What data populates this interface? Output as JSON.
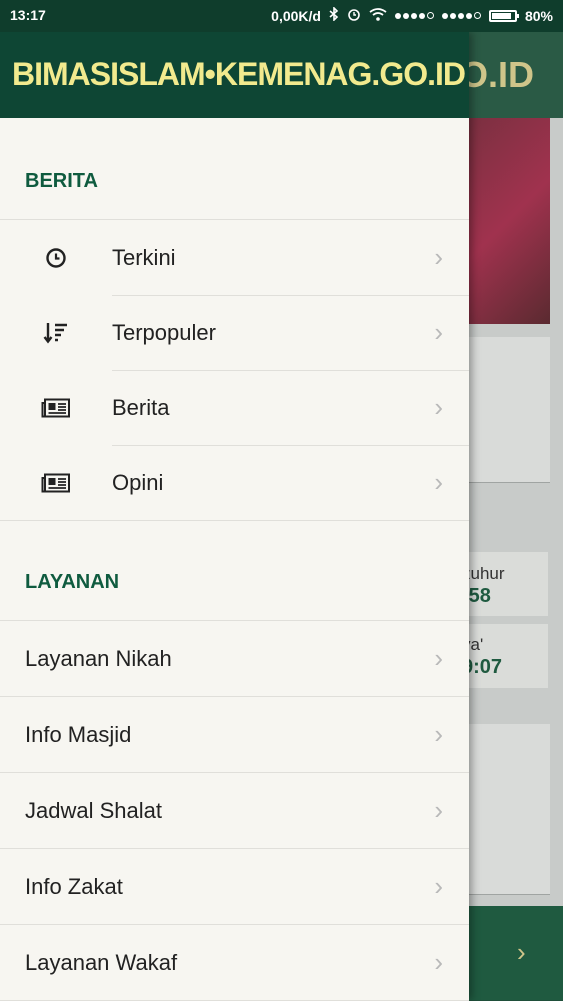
{
  "status_bar": {
    "time": "13:17",
    "speed": "0,00K/d",
    "battery": "80%"
  },
  "background_app": {
    "header_fragment": "O.ID",
    "prayer_1_name": "zuhur",
    "prayer_1_time": ":58",
    "prayer_2_name": "ya'",
    "prayer_2_time": "9:07"
  },
  "drawer": {
    "logo": "BIMASISLAM•KEMENAG.GO.ID",
    "sections": {
      "berita": {
        "title": "BERITA",
        "items": [
          {
            "label": "Terkini",
            "icon": "clock-icon"
          },
          {
            "label": "Terpopuler",
            "icon": "sort-icon"
          },
          {
            "label": "Berita",
            "icon": "newspaper-icon"
          },
          {
            "label": "Opini",
            "icon": "newspaper-icon"
          }
        ]
      },
      "layanan": {
        "title": "LAYANAN",
        "items": [
          {
            "label": "Layanan Nikah"
          },
          {
            "label": "Info Masjid"
          },
          {
            "label": "Jadwal Shalat"
          },
          {
            "label": "Info Zakat"
          },
          {
            "label": "Layanan Wakaf"
          }
        ]
      }
    }
  },
  "colors": {
    "header_green": "#0e4634",
    "accent_green": "#0f5b3f",
    "logo_yellow": "#f2ea8e",
    "drawer_bg": "#f7f6f1"
  }
}
